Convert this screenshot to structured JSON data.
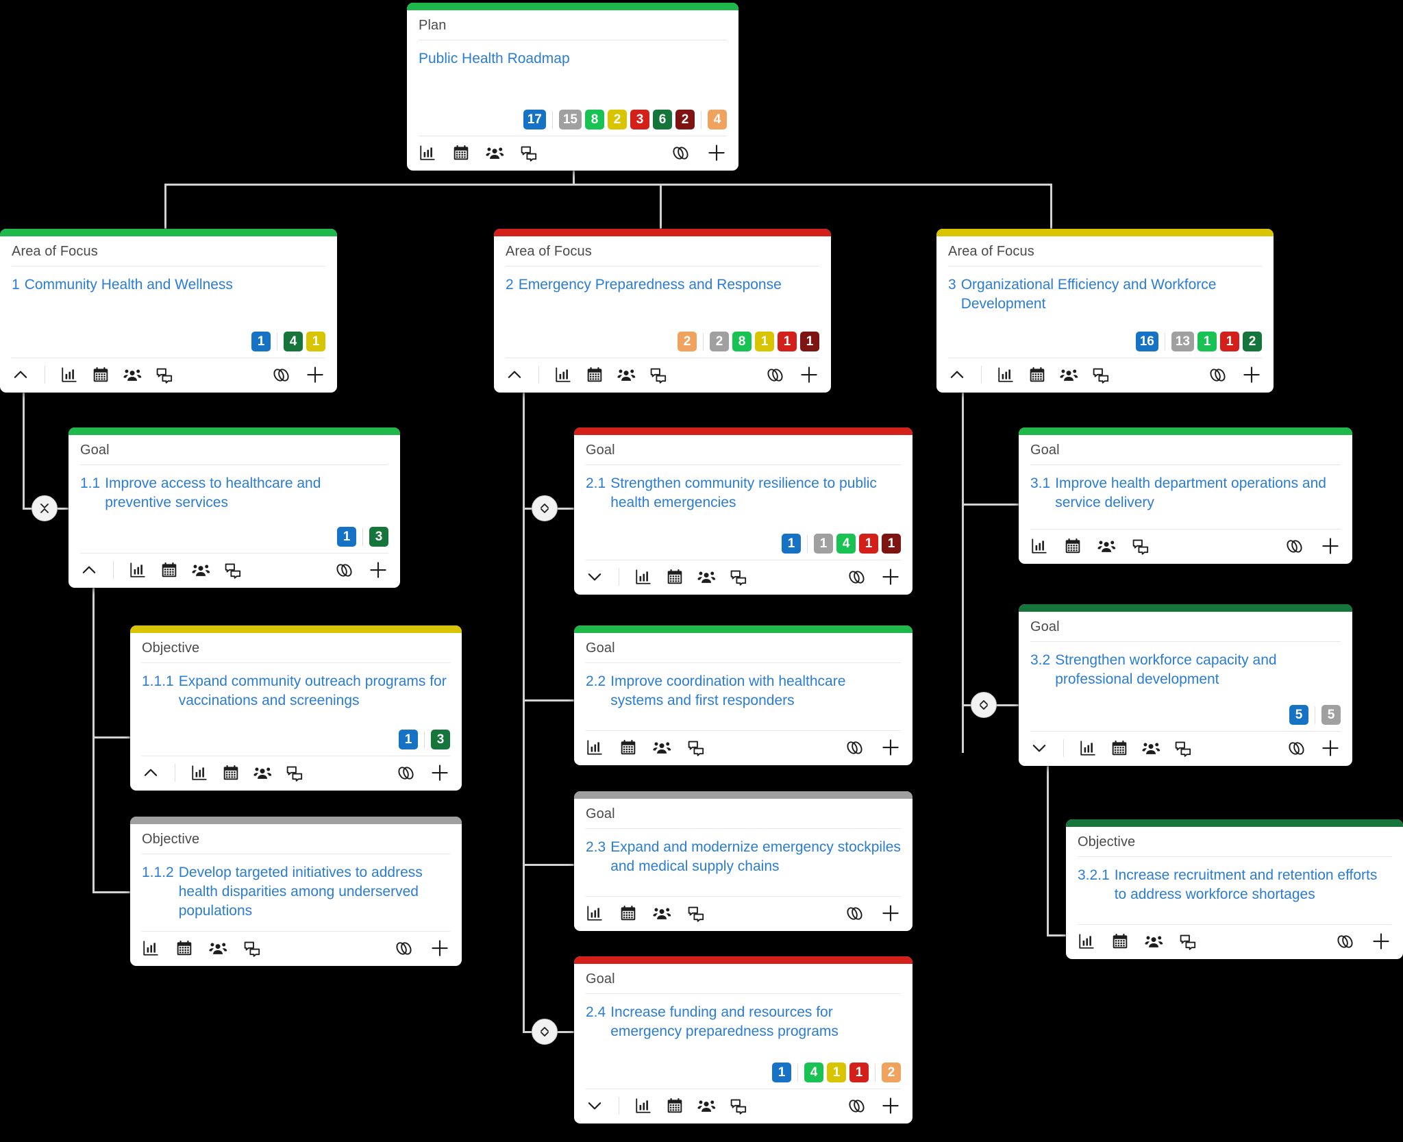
{
  "colors": {
    "green": "#1eb84b",
    "dark_green": "#16753a",
    "red": "#d4201a",
    "dark_red": "#7d1411",
    "yellow": "#d9c400",
    "gray": "#a0a0a0",
    "blue": "#1572c4",
    "orange": "#f0a35e",
    "bright_green": "#18c353",
    "link_blue": "#2b7cd3",
    "background": "#000000",
    "connector": "#d2d2d2"
  },
  "icons": {
    "chart": "bar-chart-icon",
    "calendar": "calendar-icon",
    "team": "team-icon",
    "comments": "comments-icon",
    "link": "link-icon",
    "add": "plus-icon",
    "collapse": "chevron-up-icon",
    "expand": "chevron-down-icon",
    "toggle_collapse": "collapse-toggle-icon",
    "toggle_expand": "expand-toggle-icon"
  },
  "nodes": [
    {
      "id": "plan",
      "type_label": "Plan",
      "number": "",
      "title": "Public Health Roadmap",
      "bar_color": "green",
      "chevron": "none",
      "badges": [
        {
          "value": "17",
          "color": "blue"
        },
        {
          "sep": true
        },
        {
          "value": "15",
          "color": "gray"
        },
        {
          "value": "8",
          "color": "bright_green"
        },
        {
          "value": "2",
          "color": "yellow"
        },
        {
          "value": "3",
          "color": "red"
        },
        {
          "value": "6",
          "color": "dark_green"
        },
        {
          "value": "2",
          "color": "dark_red"
        },
        {
          "sep": true
        },
        {
          "value": "4",
          "color": "orange"
        }
      ]
    },
    {
      "id": "aof1",
      "type_label": "Area of Focus",
      "number": "1",
      "title": "Community Health and Wellness",
      "bar_color": "green",
      "chevron": "collapse",
      "badges": [
        {
          "value": "1",
          "color": "blue"
        },
        {
          "sep": true
        },
        {
          "value": "4",
          "color": "dark_green"
        },
        {
          "value": "1",
          "color": "yellow"
        }
      ]
    },
    {
      "id": "aof2",
      "type_label": "Area of Focus",
      "number": "2",
      "title": "Emergency Preparedness and Response",
      "bar_color": "red",
      "chevron": "collapse",
      "badges": [
        {
          "value": "2",
          "color": "orange"
        },
        {
          "sep": true
        },
        {
          "value": "2",
          "color": "gray"
        },
        {
          "value": "8",
          "color": "bright_green"
        },
        {
          "value": "1",
          "color": "yellow"
        },
        {
          "value": "1",
          "color": "red"
        },
        {
          "value": "1",
          "color": "dark_red"
        }
      ]
    },
    {
      "id": "aof3",
      "type_label": "Area of Focus",
      "number": "3",
      "title": "Organizational Efficiency and Workforce Development",
      "bar_color": "yellow",
      "chevron": "collapse",
      "badges": [
        {
          "value": "16",
          "color": "blue"
        },
        {
          "sep": true
        },
        {
          "value": "13",
          "color": "gray"
        },
        {
          "value": "1",
          "color": "bright_green"
        },
        {
          "value": "1",
          "color": "red"
        },
        {
          "value": "2",
          "color": "dark_green"
        }
      ]
    },
    {
      "id": "goal11",
      "type_label": "Goal",
      "number": "1.1",
      "title": "Improve access to healthcare and preventive services",
      "bar_color": "green",
      "chevron": "collapse",
      "badges": [
        {
          "value": "1",
          "color": "blue"
        },
        {
          "sep": true
        },
        {
          "value": "3",
          "color": "dark_green"
        }
      ]
    },
    {
      "id": "obj111",
      "type_label": "Objective",
      "number": "1.1.1",
      "title": "Expand community outreach programs for vaccinations and screenings",
      "bar_color": "yellow",
      "chevron": "collapse",
      "badges": [
        {
          "value": "1",
          "color": "blue"
        },
        {
          "sep": true
        },
        {
          "value": "3",
          "color": "dark_green"
        }
      ]
    },
    {
      "id": "obj112",
      "type_label": "Objective",
      "number": "1.1.2",
      "title": "Develop targeted initiatives to address health disparities among underserved populations",
      "bar_color": "gray",
      "chevron": "none",
      "badges": []
    },
    {
      "id": "goal21",
      "type_label": "Goal",
      "number": "2.1",
      "title": "Strengthen community resilience to public health emergencies",
      "bar_color": "red",
      "chevron": "expand",
      "badges": [
        {
          "value": "1",
          "color": "blue"
        },
        {
          "sep": true
        },
        {
          "value": "1",
          "color": "gray"
        },
        {
          "value": "4",
          "color": "bright_green"
        },
        {
          "value": "1",
          "color": "red"
        },
        {
          "value": "1",
          "color": "dark_red"
        }
      ]
    },
    {
      "id": "goal22",
      "type_label": "Goal",
      "number": "2.2",
      "title": "Improve coordination with healthcare systems and first responders",
      "bar_color": "green",
      "chevron": "none",
      "badges": []
    },
    {
      "id": "goal23",
      "type_label": "Goal",
      "number": "2.3",
      "title": "Expand and modernize emergency stockpiles and medical supply chains",
      "bar_color": "gray",
      "chevron": "none",
      "badges": []
    },
    {
      "id": "goal24",
      "type_label": "Goal",
      "number": "2.4",
      "title": "Increase funding and resources for emergency preparedness programs",
      "bar_color": "red",
      "chevron": "expand",
      "badges": [
        {
          "value": "1",
          "color": "blue"
        },
        {
          "sep": true
        },
        {
          "value": "4",
          "color": "bright_green"
        },
        {
          "value": "1",
          "color": "yellow"
        },
        {
          "value": "1",
          "color": "red"
        },
        {
          "sep": true
        },
        {
          "value": "2",
          "color": "orange"
        }
      ]
    },
    {
      "id": "goal31",
      "type_label": "Goal",
      "number": "3.1",
      "title": "Improve health department operations and service delivery",
      "bar_color": "green",
      "chevron": "none",
      "badges": []
    },
    {
      "id": "goal32",
      "type_label": "Goal",
      "number": "3.2",
      "title": "Strengthen workforce capacity and professional development",
      "bar_color": "dark_green",
      "chevron": "expand",
      "badges": [
        {
          "value": "5",
          "color": "blue"
        },
        {
          "sep": true
        },
        {
          "value": "5",
          "color": "gray"
        }
      ]
    },
    {
      "id": "obj321",
      "type_label": "Objective",
      "number": "3.2.1",
      "title": "Increase recruitment and retention efforts to address workforce shortages",
      "bar_color": "dark_green",
      "chevron": "none",
      "badges": []
    }
  ],
  "toggles": [
    {
      "id": "tg-aof1-goal11",
      "state": "collapse"
    },
    {
      "id": "tg-aof2-goal21",
      "state": "expand"
    },
    {
      "id": "tg-aof2-goal24",
      "state": "expand"
    },
    {
      "id": "tg-aof3-goal32",
      "state": "expand"
    }
  ]
}
